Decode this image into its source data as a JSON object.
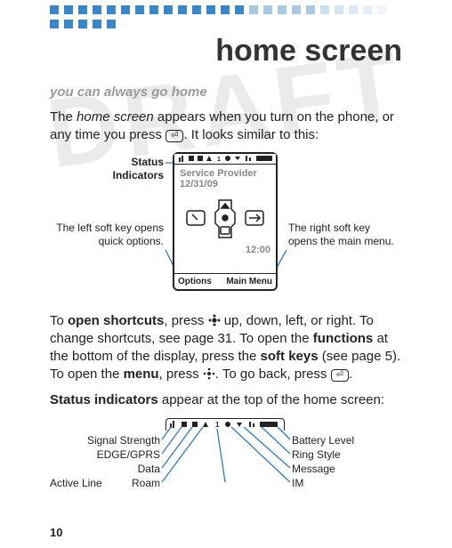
{
  "title": "home screen",
  "tagline": "you can always go home",
  "watermark": "DRAFT",
  "intro": {
    "pre": "The ",
    "hs": "home screen",
    "post1": " appears when you turn on the phone, or any time you press ",
    "key1": "⏎",
    "post2": ". It looks similar to this:"
  },
  "figure": {
    "status_label": "Status\nIndicators",
    "left_note": "The left soft key opens quick options.",
    "right_note": "The right soft key opens the main menu.",
    "service_provider": "Service Provider",
    "date": "12/31/09",
    "time": "12:00",
    "left_soft": "Options",
    "right_soft": "Main Menu"
  },
  "para2": {
    "a": "To ",
    "b": "open shortcuts",
    "c": ", press ",
    "d": " up, down, left, or right. To change shortcuts, see page 31. To open the ",
    "e": "functions",
    "f": " at the bottom of the display, press the ",
    "g": "soft keys",
    "h": " (see page 5). To open the ",
    "i": "menu",
    "j": ", press ",
    "k": ". To go back, press ",
    "l": "."
  },
  "para3": {
    "a": "Status indicators",
    "b": " appear at the top of the home screen:"
  },
  "status_labels": {
    "left": [
      "Signal Strength",
      "EDGE/GPRS",
      "Data",
      "Roam"
    ],
    "bottom": "Active Line",
    "right": [
      "Battery Level",
      "Ring Style",
      "Message",
      "IM"
    ]
  },
  "page_number": "10"
}
